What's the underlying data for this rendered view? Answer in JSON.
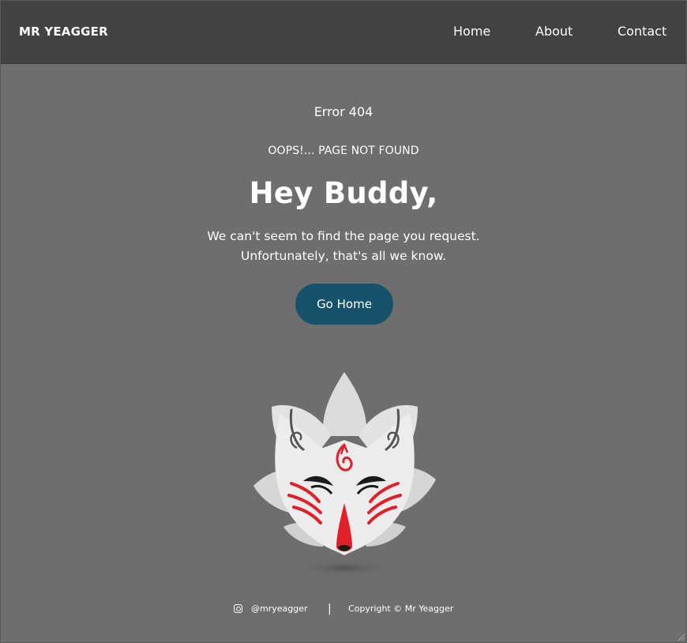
{
  "header": {
    "brand": "MR YEAGGER",
    "nav": [
      {
        "label": "Home"
      },
      {
        "label": "About"
      },
      {
        "label": "Contact"
      }
    ]
  },
  "main": {
    "error_code": "Error 404",
    "oops": "OOPS!... PAGE NOT FOUND",
    "headline": "Hey Buddy,",
    "message_line1": "We can't seem to find the page you request.",
    "message_line2": "Unfortunately, that's all we know.",
    "button_label": "Go Home",
    "illustration_icon": "kitsune-fox-mask-icon"
  },
  "footer": {
    "social_icon": "instagram-icon",
    "handle": "@mryeagger",
    "separator": "|",
    "copyright": "Copyright © Mr Yeagger"
  },
  "colors": {
    "navbar_bg": "#424242",
    "page_bg": "#6e6e6e",
    "button_bg": "#16536a",
    "mask_white": "#e6e6e6",
    "mask_red": "#e0202a"
  }
}
